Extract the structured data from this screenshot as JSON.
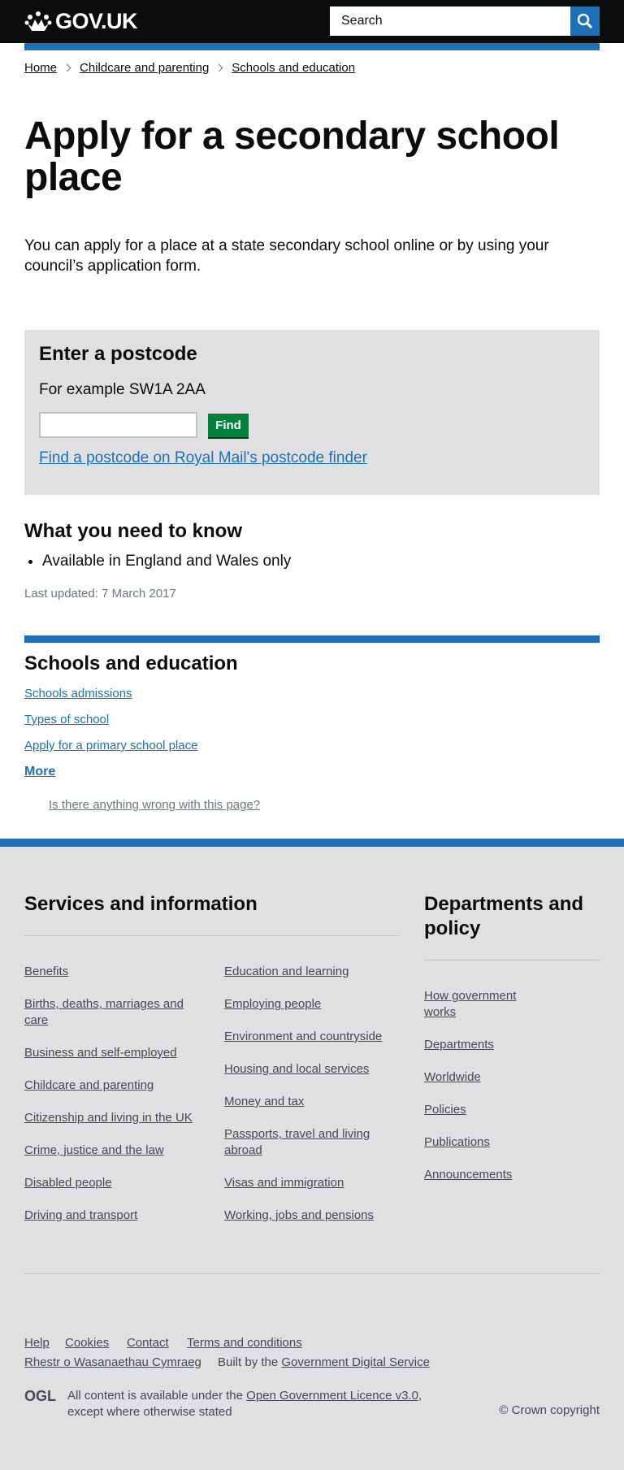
{
  "header": {
    "logo_text": "GOV.UK",
    "search_placeholder": "Search"
  },
  "breadcrumb": [
    "Home",
    "Childcare and parenting",
    "Schools and education"
  ],
  "main": {
    "title": "Apply for a secondary school place",
    "lede": "You can apply for a place at a state secondary school online or by using your council’s application form."
  },
  "postcode": {
    "title": "Enter a postcode",
    "hint": "For example SW1A 2AA",
    "input_value": "",
    "button_label": "Find",
    "finder_link": "Find a postcode on Royal Mail's postcode finder"
  },
  "need_to_know": {
    "title": "What you need to know",
    "items": [
      "Available in England and Wales only"
    ],
    "last_updated": "Last updated: 7 March 2017"
  },
  "related": {
    "title": "Schools and education",
    "links": [
      "Schools admissions",
      "Types of school",
      "Apply for a primary school place"
    ],
    "more": "More",
    "report": "Is there anything wrong with this page?"
  },
  "footer": {
    "services_title": "Services and information",
    "services_col1": [
      "Benefits",
      "Births, deaths, marriages and care",
      "Business and self-employed",
      "Childcare and parenting",
      "Citizenship and living in the UK",
      "Crime, justice and the law",
      "Disabled people",
      "Driving and transport"
    ],
    "services_col2": [
      "Education and learning",
      "Employing people",
      "Environment and countryside",
      "Housing and local services",
      "Money and tax",
      "Passports, travel and living abroad",
      "Visas and immigration",
      "Working, jobs and pensions"
    ],
    "departments_title": "Departments and policy",
    "departments": [
      "How government works",
      "Departments",
      "Worldwide",
      "Policies",
      "Publications",
      "Announcements"
    ],
    "meta_links": [
      "Help",
      "Cookies",
      "Contact",
      "Terms and conditions"
    ],
    "welsh_link": "Rhestr o Wasanaethau Cymraeg",
    "built_by_prefix": "Built by the",
    "built_by_link": "Government Digital Service",
    "licence_prefix": "All content is available under the",
    "licence_link": "Open Government Licence v3.0",
    "licence_suffix": ", except where otherwise stated",
    "ogl_logo_text": "OGL",
    "crown_copyright": "© Crown copyright"
  },
  "colors": {
    "header_bg": "#0b0c0c",
    "brand_blue": "#1d70b8",
    "find_green": "#00823b",
    "panel_grey": "#dee0e2"
  }
}
